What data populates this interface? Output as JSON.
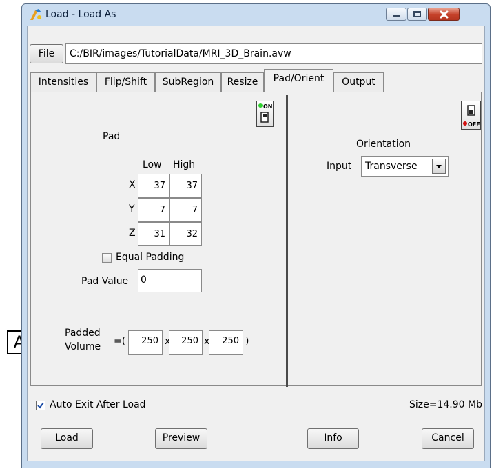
{
  "window": {
    "title": "Load - Load As"
  },
  "file": {
    "button_label": "File",
    "path": "C:/BIR/images/TutorialData/MRI_3D_Brain.avw"
  },
  "tabs": [
    "Intensities",
    "Flip/Shift",
    "SubRegion",
    "Resize",
    "Pad/Orient",
    "Output"
  ],
  "active_tab": "Pad/Orient",
  "pad": {
    "title": "Pad",
    "col_low": "Low",
    "col_high": "High",
    "rows": [
      {
        "axis": "X",
        "low": "37",
        "high": "37"
      },
      {
        "axis": "Y",
        "low": "7",
        "high": "7"
      },
      {
        "axis": "Z",
        "low": "31",
        "high": "32"
      }
    ],
    "equal_padding_label": "Equal Padding",
    "equal_padding_checked": false,
    "pad_value_label": "Pad Value",
    "pad_value": "0",
    "toggle_state": "ON",
    "padded_volume_label_1": "Padded",
    "padded_volume_label_2": "Volume",
    "open_paren": "=(",
    "close_paren": ")",
    "times": "x",
    "volume": [
      "250",
      "250",
      "250"
    ]
  },
  "orientation": {
    "title": "Orientation",
    "input_label": "Input",
    "input_value": "Transverse",
    "toggle_state": "OFF"
  },
  "footer": {
    "auto_exit_label": "Auto Exit After Load",
    "auto_exit_checked": true,
    "size_text": "Size=14.90 Mb",
    "buttons": {
      "load": "Load",
      "preview": "Preview",
      "info": "Info",
      "cancel": "Cancel"
    }
  },
  "annotation_marker": "A",
  "colors": {
    "titlebar": "#c9dcf0",
    "close_button": "#c5412a",
    "toggle_on": "#2fd02f",
    "toggle_off": "#d01010"
  },
  "icons": [
    "app-icon",
    "minimize-icon",
    "maximize-icon",
    "close-icon",
    "toggle-on-icon",
    "toggle-off-icon",
    "dropdown-arrow-icon",
    "checkmark-icon"
  ]
}
